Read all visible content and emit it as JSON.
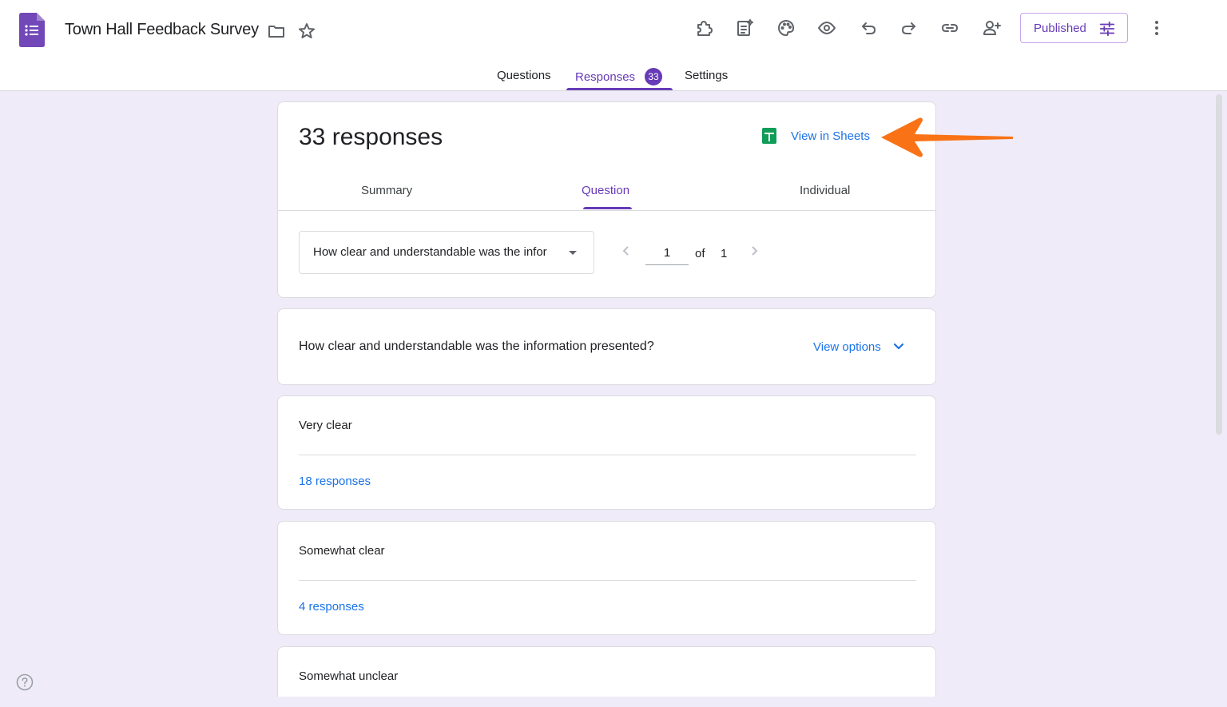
{
  "app": {
    "title": "Town Hall Feedback Survey",
    "brand_color": "#673ab7",
    "icons": [
      "forms-logo-icon",
      "folder-icon",
      "star-icon",
      "addons-icon",
      "customize-icon",
      "palette-icon",
      "preview-icon",
      "undo-icon",
      "redo-icon",
      "link-icon",
      "add-collaborator-icon",
      "settings-sliders-icon",
      "more-vert-icon"
    ]
  },
  "header": {
    "published_label": "Published"
  },
  "tabs": {
    "questions": "Questions",
    "responses": "Responses",
    "responses_badge": "33",
    "settings": "Settings",
    "active": "Responses"
  },
  "summary_card": {
    "count_label": "33 responses",
    "view_in_sheets": "View in Sheets",
    "subtabs": {
      "summary": "Summary",
      "question": "Question",
      "individual": "Individual",
      "active": "Question"
    },
    "question_select": "How clear and understandable was the infor",
    "pager": {
      "current": "1",
      "of": "of",
      "total": "1"
    }
  },
  "question_card": {
    "text": "How clear and understandable was the information presented?",
    "view_options": "View options"
  },
  "answers": [
    {
      "text": "Very clear",
      "count": "18 responses"
    },
    {
      "text": "Somewhat clear",
      "count": "4 responses"
    },
    {
      "text": "Somewhat unclear"
    }
  ],
  "annotation": {
    "arrow_color": "#f97316"
  }
}
